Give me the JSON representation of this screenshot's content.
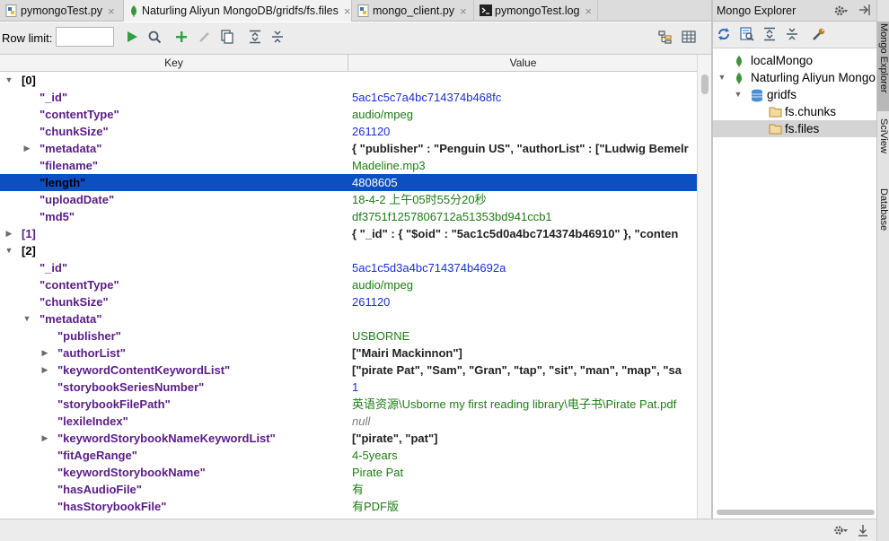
{
  "tabs": [
    {
      "label": "pymongoTest.py",
      "icon": "python-file-icon",
      "active": false
    },
    {
      "label": "Naturling Aliyun MongoDB/gridfs/fs.files",
      "icon": "mongo-leaf-icon",
      "active": true
    },
    {
      "label": "mongo_client.py",
      "icon": "python-file-icon",
      "active": false
    },
    {
      "label": "pymongoTest.log",
      "icon": "terminal-icon",
      "active": false
    }
  ],
  "toolbar": {
    "row_limit_label": "Row limit:",
    "row_limit_value": "",
    "buttons": [
      "run-icon",
      "find-icon",
      "add-icon",
      "edit-icon",
      "copy-icon",
      "expand-all-icon",
      "collapse-all-icon"
    ],
    "right_buttons": [
      "tree-view-icon",
      "table-view-icon"
    ]
  },
  "grid": {
    "headers": {
      "key": "Key",
      "value": "Value"
    },
    "rows": [
      {
        "key": "[0]",
        "value": "",
        "level": 0,
        "toggle": "open",
        "kind": "bracket"
      },
      {
        "key": "\"_id\"",
        "value": "5ac1c5c7a4bc714374b468fc",
        "level": 1,
        "toggle": "",
        "kind": "num"
      },
      {
        "key": "\"contentType\"",
        "value": "audio/mpeg",
        "level": 1,
        "toggle": "",
        "kind": "str"
      },
      {
        "key": "\"chunkSize\"",
        "value": "261120",
        "level": 1,
        "toggle": "",
        "kind": "num"
      },
      {
        "key": "\"metadata\"",
        "value": "{ \"publisher\" : \"Penguin US\", \"authorList\" : [\"Ludwig Bemelr",
        "level": 1,
        "toggle": "closed",
        "kind": "obj"
      },
      {
        "key": "\"filename\"",
        "value": "Madeline.mp3",
        "level": 1,
        "toggle": "",
        "kind": "str"
      },
      {
        "key": "\"length\"",
        "value": "4808605",
        "level": 1,
        "toggle": "",
        "kind": "num",
        "selected": true
      },
      {
        "key": "\"uploadDate\"",
        "value": "18-4-2 上午05时55分20秒",
        "level": 1,
        "toggle": "",
        "kind": "str"
      },
      {
        "key": "\"md5\"",
        "value": "df3751f1257806712a51353bd941ccb1",
        "level": 1,
        "toggle": "",
        "kind": "str"
      },
      {
        "key": "[1]",
        "value": "{ \"_id\" : { \"$oid\" : \"5ac1c5d0a4bc714374b46910\" }, \"conten",
        "level": 0,
        "toggle": "closed",
        "kind": "obj"
      },
      {
        "key": "[2]",
        "value": "",
        "level": 0,
        "toggle": "open",
        "kind": "bracket"
      },
      {
        "key": "\"_id\"",
        "value": "5ac1c5d3a4bc714374b4692a",
        "level": 1,
        "toggle": "",
        "kind": "num"
      },
      {
        "key": "\"contentType\"",
        "value": "audio/mpeg",
        "level": 1,
        "toggle": "",
        "kind": "str"
      },
      {
        "key": "\"chunkSize\"",
        "value": "261120",
        "level": 1,
        "toggle": "",
        "kind": "num"
      },
      {
        "key": "\"metadata\"",
        "value": "",
        "level": 1,
        "toggle": "open",
        "kind": "obj"
      },
      {
        "key": "\"publisher\"",
        "value": "USBORNE",
        "level": 2,
        "toggle": "",
        "kind": "str"
      },
      {
        "key": "\"authorList\"",
        "value": "[\"Mairi Mackinnon\"]",
        "level": 2,
        "toggle": "closed",
        "kind": "obj"
      },
      {
        "key": "\"keywordContentKeywordList\"",
        "value": "[\"pirate Pat\", \"Sam\", \"Gran\", \"tap\", \"sit\", \"man\", \"map\", \"sa",
        "level": 2,
        "toggle": "closed",
        "kind": "obj"
      },
      {
        "key": "\"storybookSeriesNumber\"",
        "value": "1",
        "level": 2,
        "toggle": "",
        "kind": "num"
      },
      {
        "key": "\"storybookFilePath\"",
        "value": "英语资源\\Usborne my first reading library\\电子书\\Pirate Pat.pdf",
        "level": 2,
        "toggle": "",
        "kind": "str"
      },
      {
        "key": "\"lexileIndex\"",
        "value": "null",
        "level": 2,
        "toggle": "",
        "kind": "null"
      },
      {
        "key": "\"keywordStorybookNameKeywordList\"",
        "value": "[\"pirate\", \"pat\"]",
        "level": 2,
        "toggle": "closed",
        "kind": "obj"
      },
      {
        "key": "\"fitAgeRange\"",
        "value": "4-5years",
        "level": 2,
        "toggle": "",
        "kind": "str"
      },
      {
        "key": "\"keywordStorybookName\"",
        "value": "Pirate Pat",
        "level": 2,
        "toggle": "",
        "kind": "str"
      },
      {
        "key": "\"hasAudioFile\"",
        "value": "有",
        "level": 2,
        "toggle": "",
        "kind": "str"
      },
      {
        "key": "\"hasStorybookFile\"",
        "value": "有PDF版",
        "level": 2,
        "toggle": "",
        "kind": "str"
      }
    ]
  },
  "explorer": {
    "title": "Mongo Explorer",
    "tools": [
      "refresh-icon",
      "query-icon",
      "expand-all-icon",
      "collapse-all-icon",
      "settings-wrench-icon"
    ],
    "tree": [
      {
        "label": "localMongo",
        "level": 0,
        "toggle": "",
        "icon": "mongo-leaf-icon"
      },
      {
        "label": "Naturling Aliyun Mongo",
        "level": 0,
        "toggle": "open",
        "icon": "mongo-leaf-icon"
      },
      {
        "label": "gridfs",
        "level": 1,
        "toggle": "open",
        "icon": "database-icon"
      },
      {
        "label": "fs.chunks",
        "level": 2,
        "toggle": "",
        "icon": "folder-icon"
      },
      {
        "label": "fs.files",
        "level": 2,
        "toggle": "",
        "icon": "folder-icon",
        "selected": true
      }
    ]
  },
  "side_tabs": [
    "Mongo Explorer",
    "SciView",
    "Database"
  ],
  "colors": {
    "key": "#5a1c87",
    "number": "#1a2fd6",
    "string": "#1e7d14",
    "selection": "#0b4fc4",
    "leaf": "#2e9d3a"
  }
}
